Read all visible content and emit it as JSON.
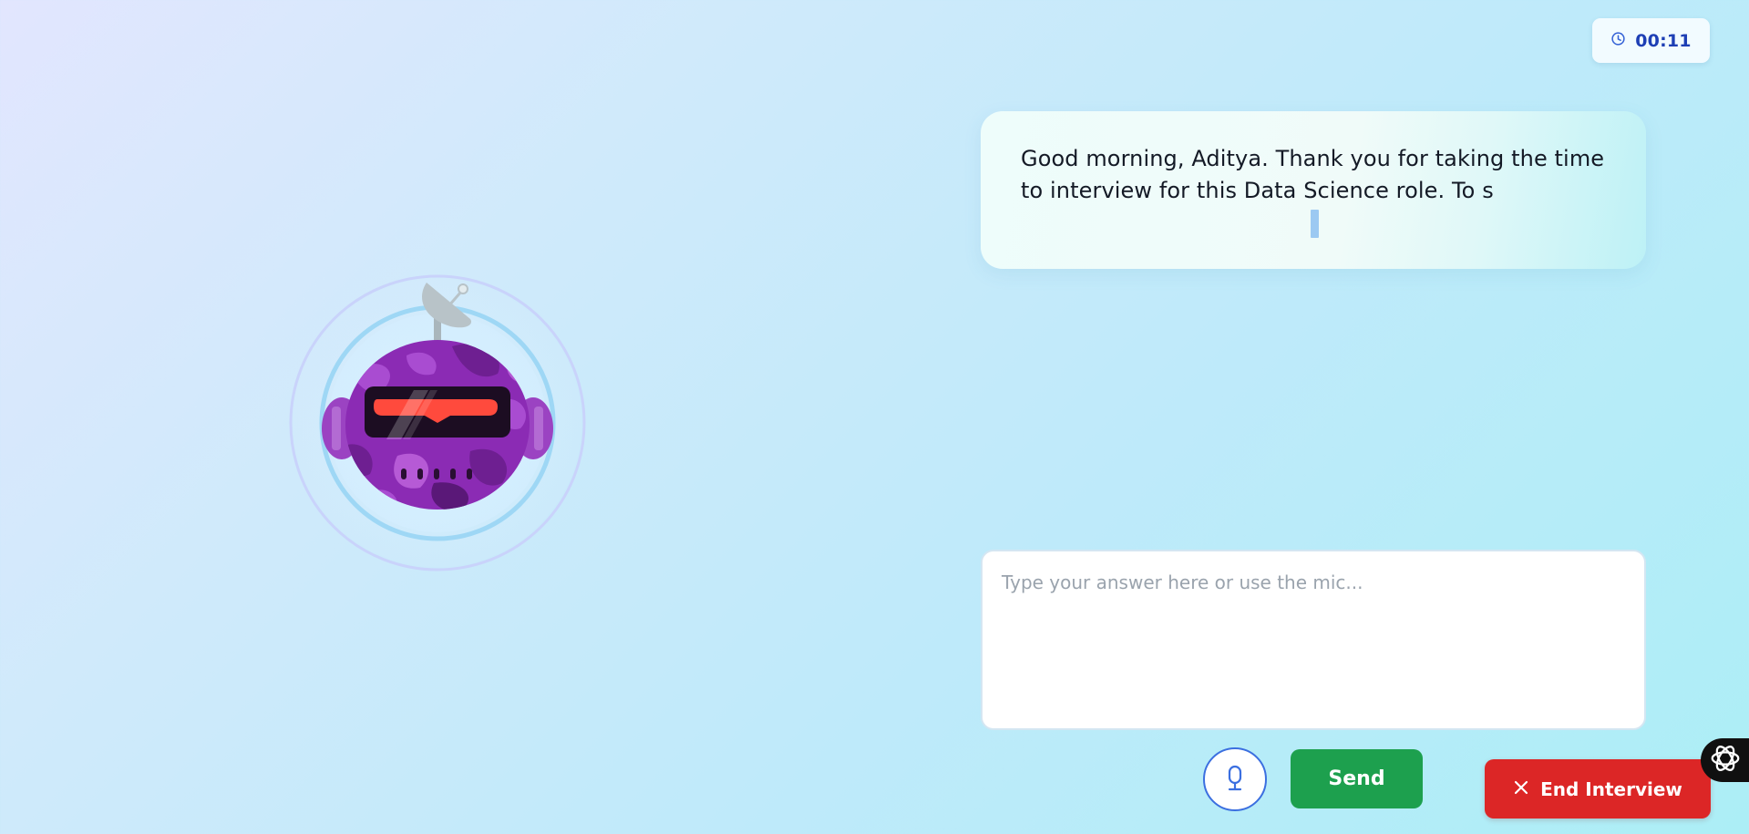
{
  "timer": {
    "value": "00:11",
    "icon": "clock-icon"
  },
  "interviewer": {
    "message": "Good morning, Aditya. Thank you for taking the time to interview for this Data Science role. To s",
    "avatar_icon": "robot-avatar-icon"
  },
  "answer": {
    "value": "",
    "placeholder": "Type your answer here or use the mic..."
  },
  "controls": {
    "mic_icon": "microphone-icon",
    "send_label": "Send",
    "end_label": "End Interview",
    "end_icon": "close-icon"
  },
  "colors": {
    "send": "#1da04e",
    "end": "#dc2626",
    "mic_border": "#3b6fe0",
    "timer_text": "#1e3fb5",
    "robot_body": "#8b2bb4"
  },
  "floating_logo_icon": "openai-logo-icon"
}
